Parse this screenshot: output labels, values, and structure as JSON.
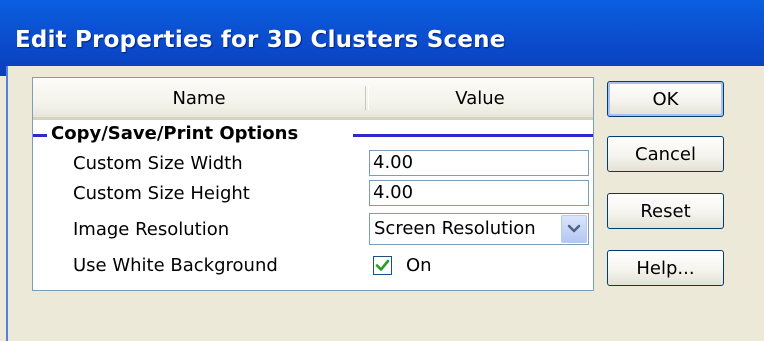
{
  "window": {
    "title": "Edit Properties for 3D Clusters Scene"
  },
  "grid": {
    "columns": [
      "Name",
      "Value"
    ],
    "group": {
      "label": "Copy/Save/Print Options"
    },
    "properties": [
      {
        "name": "Custom Size Width",
        "value": "4.00"
      },
      {
        "name": "Custom Size Height",
        "value": "4.00"
      },
      {
        "name": "Image Resolution",
        "value": "Screen Resolution"
      },
      {
        "name": "Use White Background",
        "value": "On"
      }
    ]
  },
  "buttons": {
    "ok": "OK",
    "cancel": "Cancel",
    "reset": "Reset",
    "help": "Help..."
  },
  "colors": {
    "titlebar": "#0a4fd0",
    "group_line": "#2b2bd0",
    "check_mark": "#21a121"
  },
  "icons": {
    "dropdown": "chevron-down-icon",
    "checkbox": "checkmark-icon"
  }
}
